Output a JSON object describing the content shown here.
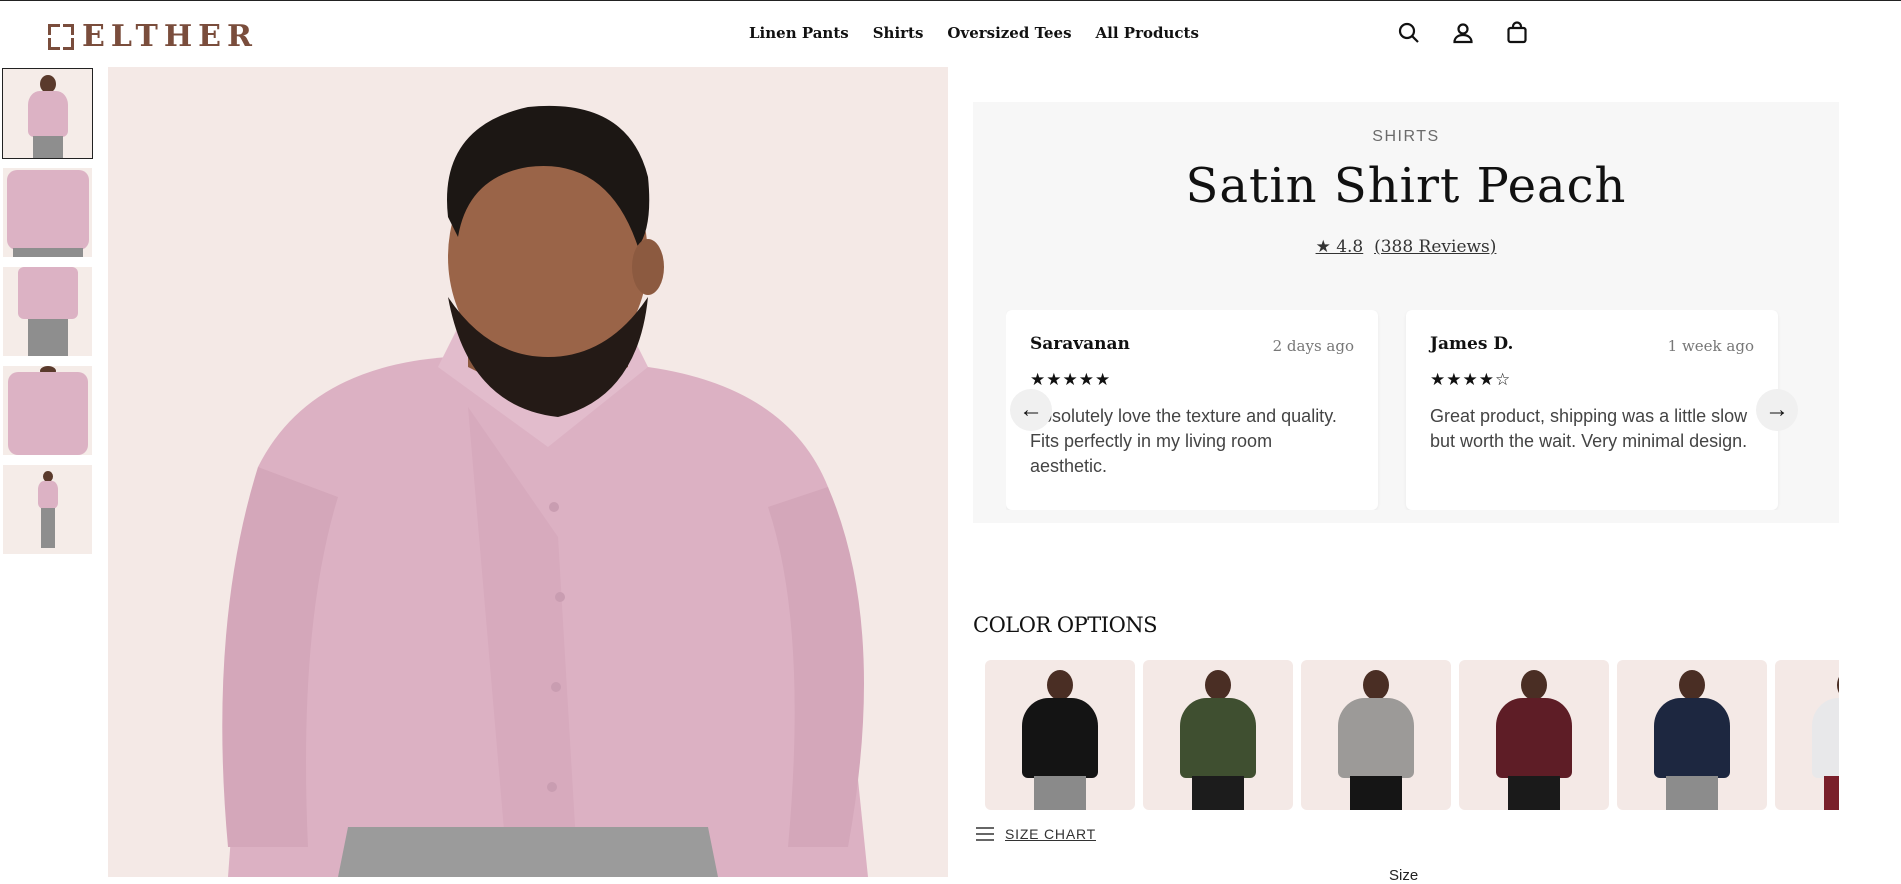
{
  "brand": {
    "name": "ELTHER",
    "logo_color": "#7a4d3c"
  },
  "nav": {
    "items": [
      "Linen Pants",
      "Shirts",
      "Oversized Tees",
      "All Products"
    ]
  },
  "header_icons": [
    "search-icon",
    "account-icon",
    "bag-icon"
  ],
  "gallery": {
    "thumbnails": [
      "front-view",
      "close-up",
      "side-view",
      "detail-view",
      "full-length-view"
    ],
    "active_index": 0
  },
  "product": {
    "category": "SHIRTS",
    "title": "Satin Shirt Peach",
    "rating_text": "★ 4.8",
    "reviews_text": "(388 Reviews)"
  },
  "reviews": [
    {
      "name": "Saravanan",
      "date": "2 days ago",
      "stars": "★★★★★",
      "text": "Absolutely love the texture and quality. Fits perfectly in my living room aesthetic."
    },
    {
      "name": "James D.",
      "date": "1 week ago",
      "stars": "★★★★☆",
      "text": "Great product, shipping was a little slow but worth the wait. Very minimal design."
    }
  ],
  "carousel": {
    "prev_label": "←",
    "next_label": "→"
  },
  "color_options": {
    "heading": "COLOR OPTIONS",
    "swatches": [
      {
        "shirt": "#141414",
        "pants": "#8a8a8a"
      },
      {
        "shirt": "#3f4f30",
        "pants": "#1c1c1c"
      },
      {
        "shirt": "#9c9a98",
        "pants": "#151515"
      },
      {
        "shirt": "#5e1d26",
        "pants": "#1a1a1a"
      },
      {
        "shirt": "#1d2740",
        "pants": "#8c8c8c"
      },
      {
        "shirt": "#e8e8ea",
        "pants": "#7a1f2a"
      }
    ]
  },
  "size_chart": {
    "label": "SIZE CHART"
  },
  "size_label": "Size"
}
